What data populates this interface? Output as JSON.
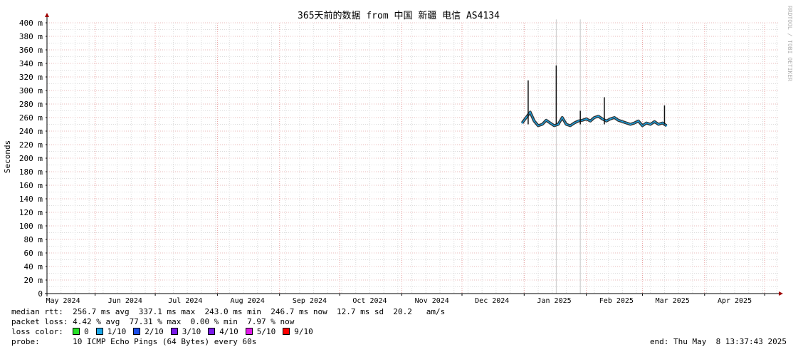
{
  "chart_data": {
    "type": "line",
    "title": "365天前的数据 from 中国 新疆 电信 AS4134",
    "ylabel": "Seconds",
    "ylim": [
      0,
      400
    ],
    "ytick_values": [
      0,
      20,
      40,
      60,
      80,
      100,
      120,
      140,
      160,
      180,
      200,
      220,
      240,
      260,
      280,
      300,
      320,
      340,
      360,
      380,
      400
    ],
    "ytick_labels": [
      "0",
      "20 m",
      "40 m",
      "60 m",
      "80 m",
      "100 m",
      "120 m",
      "140 m",
      "160 m",
      "180 m",
      "200 m",
      "220 m",
      "240 m",
      "260 m",
      "280 m",
      "300 m",
      "320 m",
      "340 m",
      "360 m",
      "380 m",
      "400 m"
    ],
    "x_start": "2024-05-08",
    "x_end": "2025-05-08",
    "xtick_labels": [
      "May 2024",
      "Jun 2024",
      "Jul 2024",
      "Aug 2024",
      "Sep 2024",
      "Oct 2024",
      "Nov 2024",
      "Dec 2024",
      "Jan 2025",
      "Feb 2025",
      "Mar 2025",
      "Apr 2025"
    ],
    "xtick_label_dates": [
      "2024-05-16",
      "2024-06-16",
      "2024-07-16",
      "2024-08-16",
      "2024-09-16",
      "2024-10-16",
      "2024-11-16",
      "2024-12-16",
      "2025-01-16",
      "2025-02-16",
      "2025-03-16",
      "2025-04-16"
    ],
    "month_grid_dates": [
      "2024-06-01",
      "2024-07-01",
      "2024-08-01",
      "2024-09-01",
      "2024-10-01",
      "2024-11-01",
      "2024-12-01",
      "2025-01-01",
      "2025-02-01",
      "2025-03-01",
      "2025-04-01",
      "2025-05-01"
    ],
    "grid": true,
    "series": [
      {
        "color": "#1aa6e8",
        "x": [
          "2024-12-31",
          "2025-01-02",
          "2025-01-04",
          "2025-01-06",
          "2025-01-08",
          "2025-01-10",
          "2025-01-12",
          "2025-01-14",
          "2025-01-16",
          "2025-01-18",
          "2025-01-20",
          "2025-01-22",
          "2025-01-24",
          "2025-01-26",
          "2025-01-28",
          "2025-01-30",
          "2025-02-01",
          "2025-02-03",
          "2025-02-05",
          "2025-02-07",
          "2025-02-09",
          "2025-02-11",
          "2025-02-13",
          "2025-02-15",
          "2025-02-17",
          "2025-02-19",
          "2025-02-21",
          "2025-02-23",
          "2025-02-25",
          "2025-02-27",
          "2025-03-01",
          "2025-03-03",
          "2025-03-05",
          "2025-03-07",
          "2025-03-09",
          "2025-03-11",
          "2025-03-13"
        ],
        "y": [
          252,
          260,
          268,
          255,
          248,
          250,
          256,
          252,
          248,
          250,
          260,
          250,
          248,
          252,
          255,
          256,
          258,
          255,
          260,
          262,
          258,
          255,
          258,
          260,
          256,
          254,
          252,
          250,
          252,
          255,
          248,
          252,
          250,
          254,
          250,
          252,
          248
        ],
        "spikes": [
          {
            "x": "2025-01-03",
            "y": 315
          },
          {
            "x": "2025-01-17",
            "y": 337
          },
          {
            "x": "2025-01-29",
            "y": 270
          },
          {
            "x": "2025-02-10",
            "y": 290
          },
          {
            "x": "2025-03-12",
            "y": 278
          }
        ]
      }
    ],
    "loss_spikes": [
      {
        "x": "2025-01-17",
        "y": 405
      },
      {
        "x": "2025-01-29",
        "y": 405
      }
    ]
  },
  "side_label": "RRDTOOL / TOBI OETIKER",
  "stats": {
    "median_rtt": "median rtt:  256.7 ms avg  337.1 ms max  243.0 ms min  246.7 ms now  12.7 ms sd  20.2   am/s",
    "packet_loss": "packet loss: 4.42 % avg  77.31 % max  0.00 % min  7.97 % now",
    "loss_color_label": "loss color:",
    "loss_colors": [
      {
        "label": "0",
        "color": "#26e026"
      },
      {
        "label": "1/10",
        "color": "#1aa6e8"
      },
      {
        "label": "2/10",
        "color": "#1a4ce8"
      },
      {
        "label": "3/10",
        "color": "#7a1ae8"
      },
      {
        "label": "4/10",
        "color": "#7a1ae8"
      },
      {
        "label": "5/10",
        "color": "#e01ae8"
      },
      {
        "label": "9/10",
        "color": "#ff0000"
      }
    ],
    "probe": "probe:       10 ICMP Echo Pings (64 Bytes) every 60s",
    "end": "end: Thu May  8 13:37:43 2025"
  }
}
